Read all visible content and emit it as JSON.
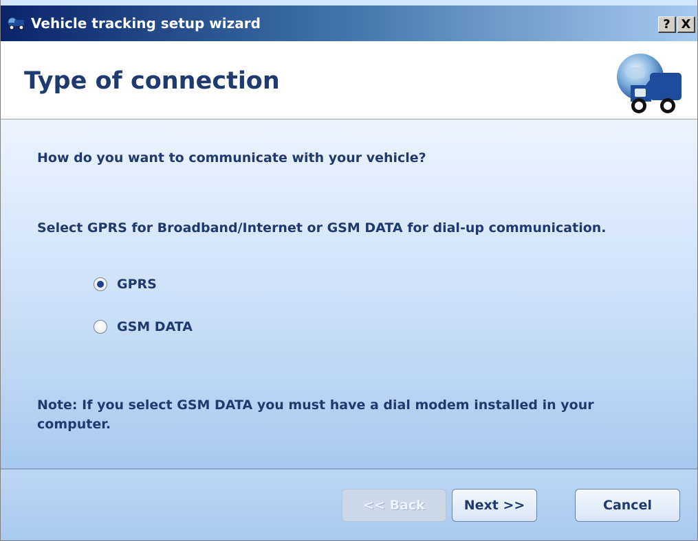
{
  "window": {
    "title": "Vehicle tracking setup wizard",
    "help_label": "?",
    "close_label": "X"
  },
  "header": {
    "title": "Type of connection",
    "logo_icon": "globe-truck-icon"
  },
  "content": {
    "question": "How do you want to communicate with your vehicle?",
    "instruction": "Select GPRS for Broadband/Internet or GSM DATA for dial-up communication.",
    "options": [
      {
        "label": "GPRS",
        "selected": true
      },
      {
        "label": "GSM DATA",
        "selected": false
      }
    ],
    "note": "Note: If you select GSM DATA you must have a dial modem installed in your computer."
  },
  "footer": {
    "back_label": "<< Back",
    "next_label": "Next >>",
    "cancel_label": "Cancel",
    "back_enabled": false
  },
  "colors": {
    "title_bar_start": "#0a246a",
    "title_bar_end": "#a6caf0",
    "text": "#1f3a6e",
    "panel_top": "#ecf3fd",
    "panel_bottom": "#a7c9f0"
  }
}
